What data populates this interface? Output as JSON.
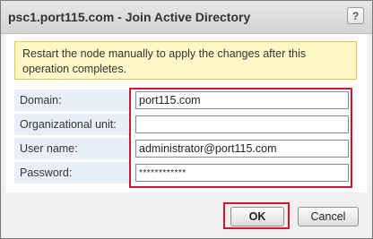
{
  "dialog": {
    "title": "psc1.port115.com - Join Active Directory",
    "help_icon": "question-mark-icon",
    "help_label": "?"
  },
  "warning": {
    "text": "Restart the node manually to apply the changes after this operation completes."
  },
  "form": {
    "domain": {
      "label": "Domain:",
      "value": "port115.com"
    },
    "org_unit": {
      "label": "Organizational unit:",
      "value": ""
    },
    "username": {
      "label": "User name:",
      "value": "administrator@port115.com"
    },
    "password": {
      "label": "Password:",
      "value": "************"
    }
  },
  "buttons": {
    "ok": "OK",
    "cancel": "Cancel"
  },
  "colors": {
    "highlight": "#d0172f",
    "warning_bg": "#fff8c6",
    "label_bg": "#e9eff6"
  }
}
